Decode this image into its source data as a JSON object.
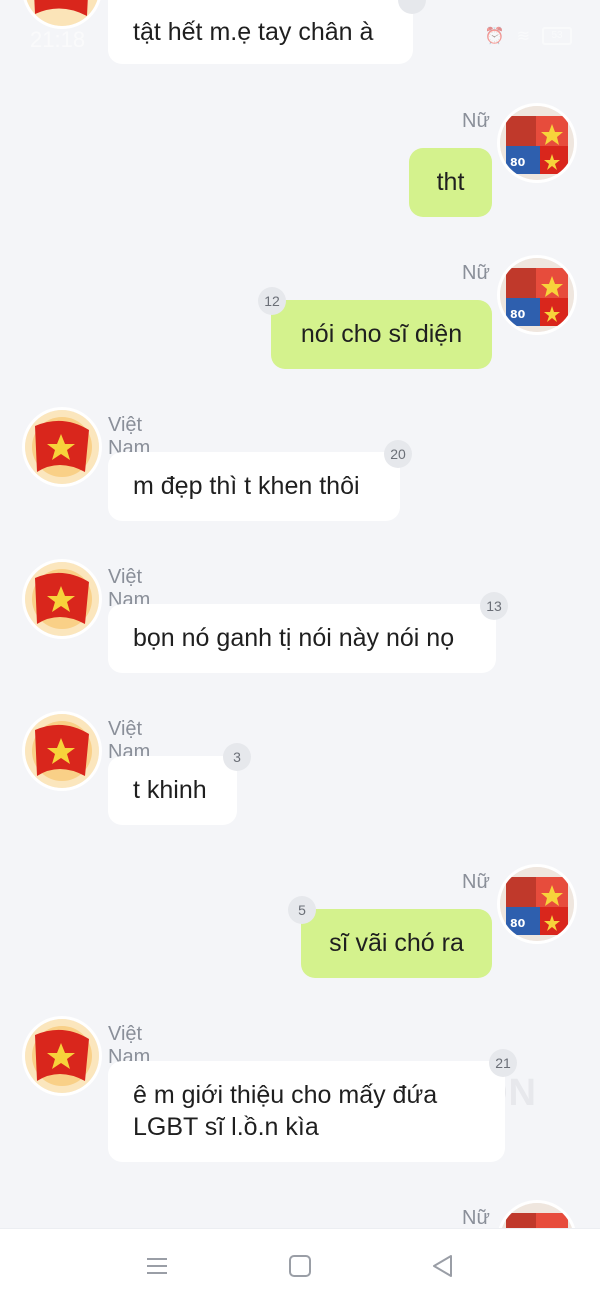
{
  "status_bar": {
    "time": "21:18",
    "battery": "53"
  },
  "colors": {
    "background": "#f4f5f8",
    "incoming_bubble": "#ffffff",
    "outgoing_bubble": "#d4f28d",
    "badge": "#e6e8ec"
  },
  "messages": [
    {
      "direction": "in",
      "sender": "",
      "text": "tật hết m.ẹ tay chân à",
      "count": ""
    },
    {
      "direction": "out",
      "sender": "Nữ",
      "text": "tht",
      "count": ""
    },
    {
      "direction": "out",
      "sender": "Nữ",
      "text": "nói cho sĩ diện",
      "count": "12"
    },
    {
      "direction": "in",
      "sender": "Việt Nam",
      "text": "m đẹp thì t khen thôi",
      "count": "20"
    },
    {
      "direction": "in",
      "sender": "Việt Nam",
      "text": "bọn nó ganh tị nói này nói nọ",
      "count": "13"
    },
    {
      "direction": "in",
      "sender": "Việt Nam",
      "text": "t khinh",
      "count": "3"
    },
    {
      "direction": "out",
      "sender": "Nữ",
      "text": "sĩ vãi chó ra",
      "count": "5"
    },
    {
      "direction": "in",
      "sender": "Việt Nam",
      "text_line1": "ê m giới thiệu cho mấy đứa",
      "text_line2": "LGBT sĩ l.ồ.n kìa",
      "count": "21"
    },
    {
      "direction": "out",
      "sender": "Nữ",
      "text": "",
      "count": ""
    }
  ],
  "watermark": "ON",
  "avatars": {
    "female_avatar_badge": "80"
  },
  "icons": [
    "menu-icon",
    "home-icon",
    "back-icon",
    "star-icon",
    "flag-icon"
  ]
}
